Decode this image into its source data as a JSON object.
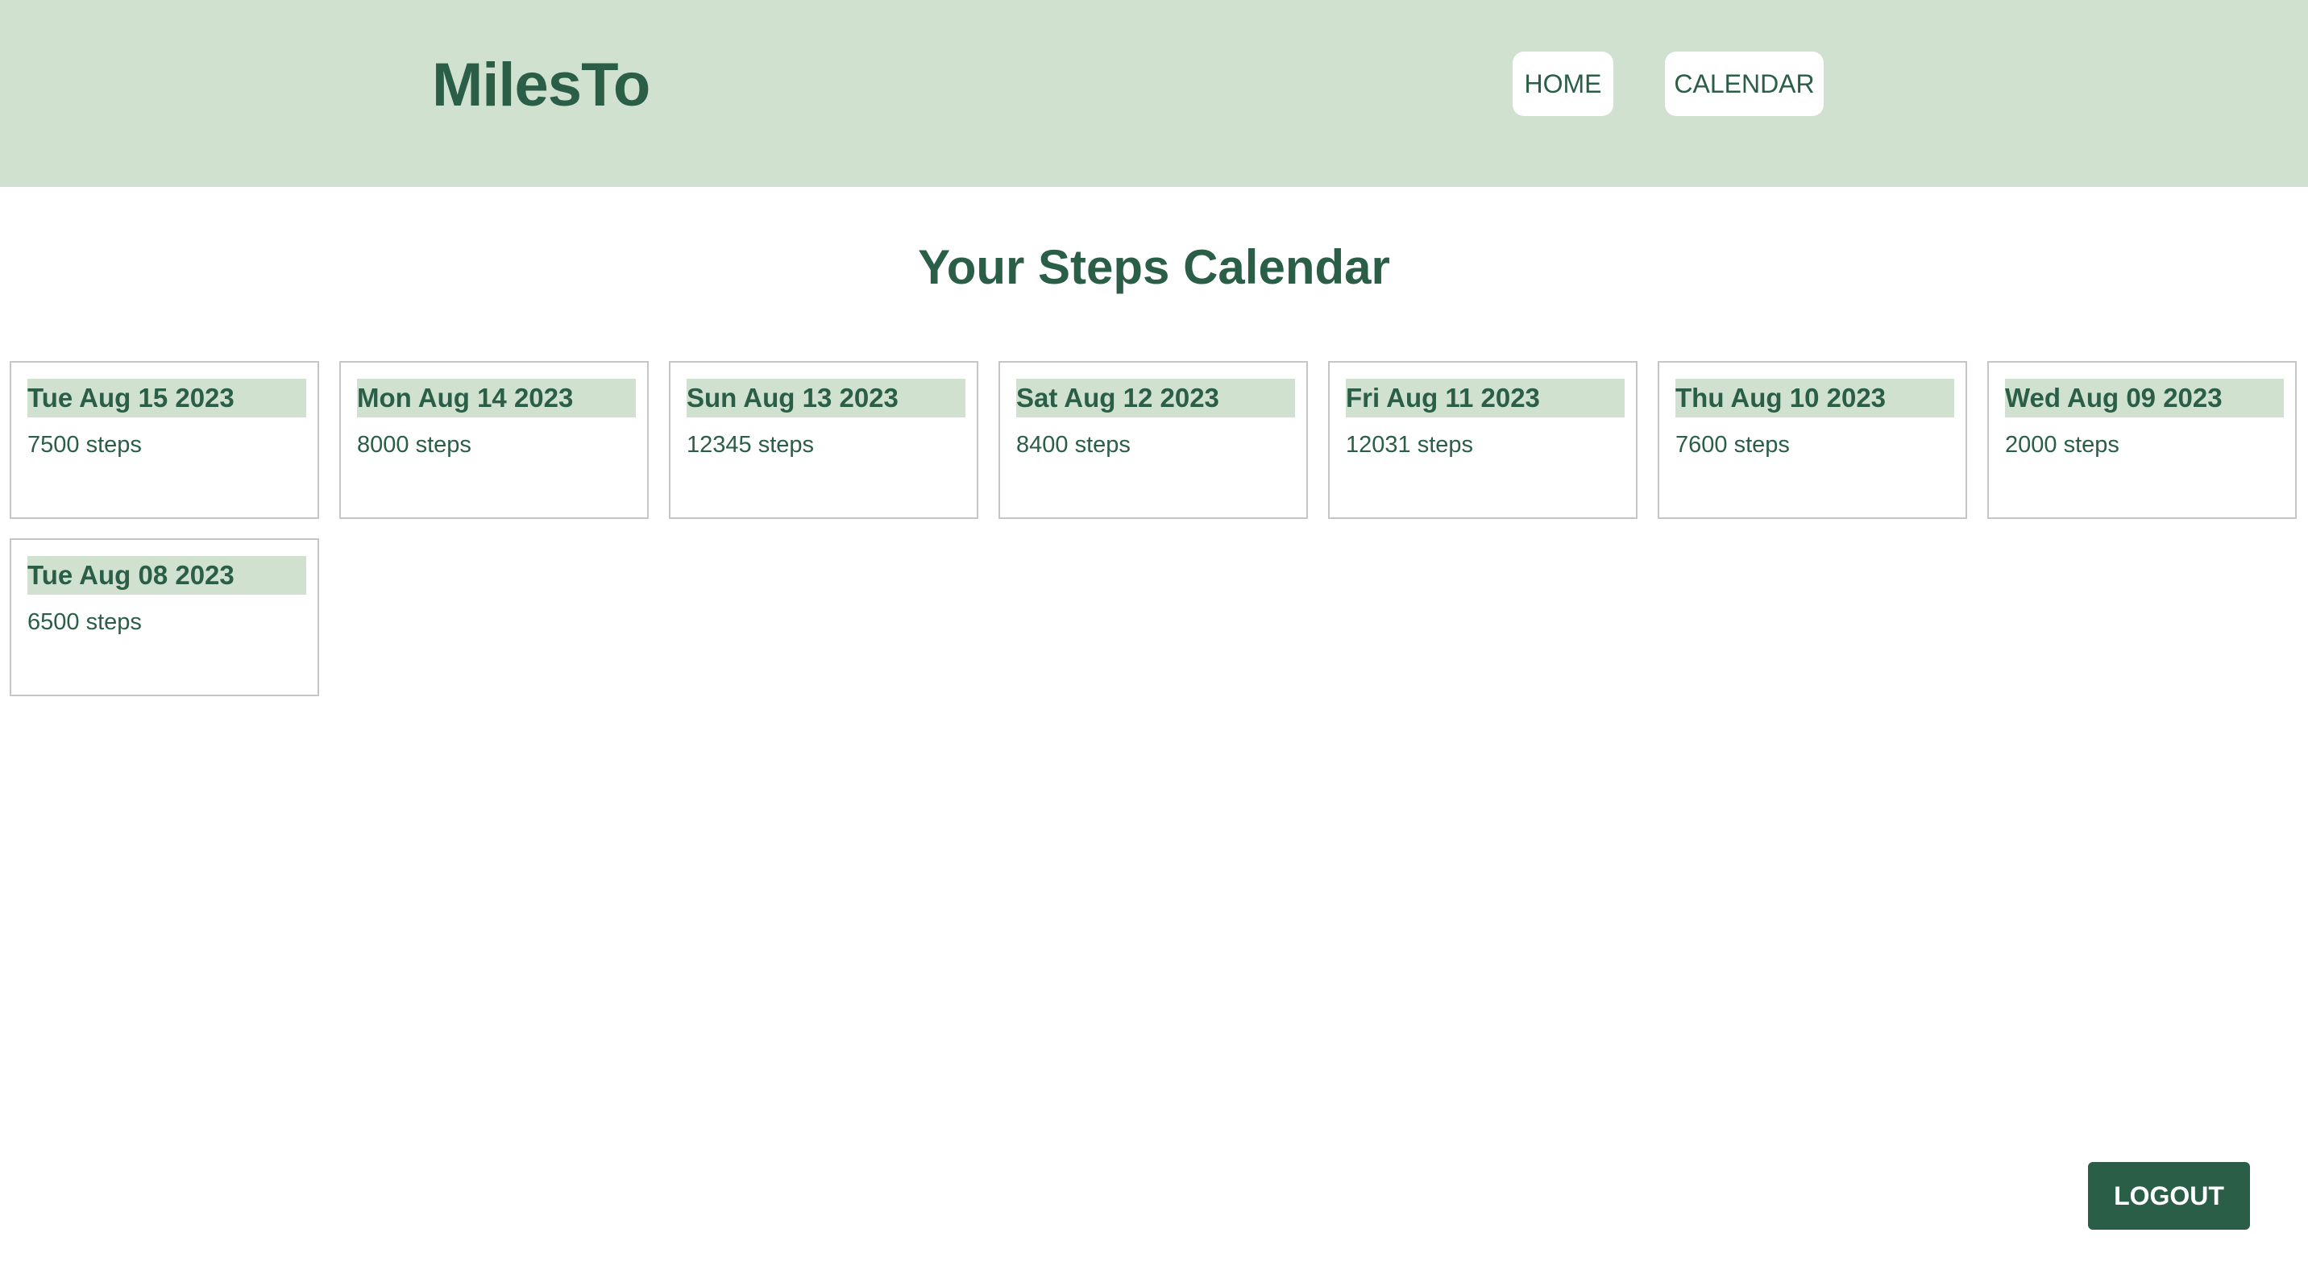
{
  "app": {
    "brand": "MilesTo"
  },
  "nav": {
    "home_label": "HOME",
    "calendar_label": "CALENDAR"
  },
  "main": {
    "title": "Your Steps Calendar",
    "entries": [
      {
        "date": "Tue Aug 15 2023",
        "steps": "7500 steps"
      },
      {
        "date": "Mon Aug 14 2023",
        "steps": "8000 steps"
      },
      {
        "date": "Sun Aug 13 2023",
        "steps": "12345 steps"
      },
      {
        "date": "Sat Aug 12 2023",
        "steps": "8400 steps"
      },
      {
        "date": "Fri Aug 11 2023",
        "steps": "12031 steps"
      },
      {
        "date": "Thu Aug 10 2023",
        "steps": "7600 steps"
      },
      {
        "date": "Wed Aug 09 2023",
        "steps": "2000 steps"
      },
      {
        "date": "Tue Aug 08 2023",
        "steps": "6500 steps"
      }
    ]
  },
  "footer": {
    "logout_label": "LOGOUT"
  },
  "colors": {
    "header_bg": "#d0e1d0",
    "primary": "#2a5e47",
    "card_border": "#c6c6c6",
    "button_bg": "#ffffff"
  }
}
